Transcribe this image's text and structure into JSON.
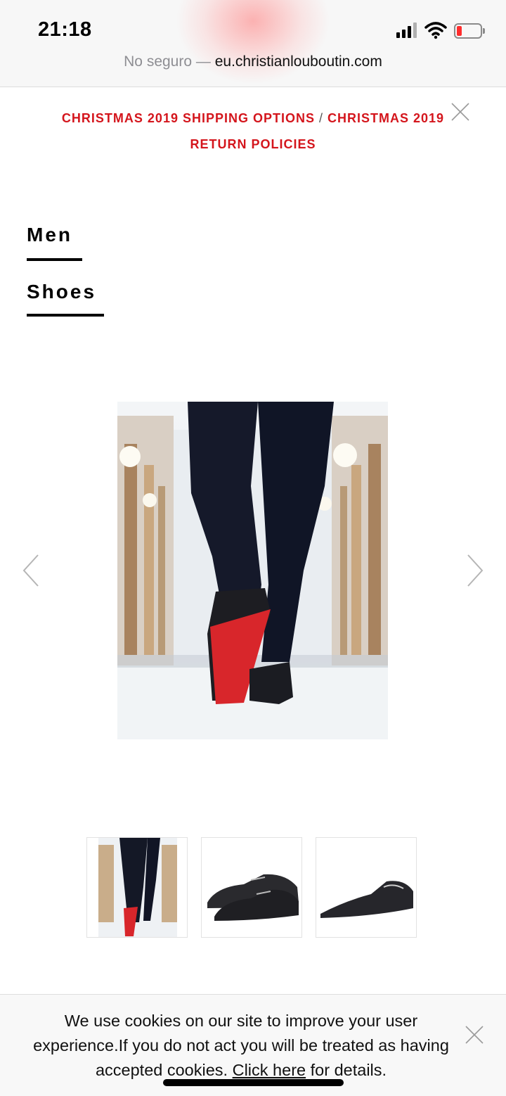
{
  "status_bar": {
    "time": "21:18",
    "icons": [
      "signal-icon",
      "wifi-icon",
      "battery-icon"
    ],
    "battery_color": "#ff2d2d"
  },
  "browser": {
    "security_label": "No seguro",
    "separator": "—",
    "domain": "eu.christianlouboutin.com"
  },
  "announcement": {
    "link_1": "CHRISTMAS 2019 SHIPPING OPTIONS",
    "separator": "/",
    "link_2": "CHRISTMAS 2019 RETURN POLICIES",
    "close_icon": "close-icon",
    "color": "#d4151c"
  },
  "breadcrumb": {
    "items": [
      {
        "label": "Men"
      },
      {
        "label": "Shoes"
      }
    ]
  },
  "carousel": {
    "prev_icon": "chevron-left-icon",
    "next_icon": "chevron-right-icon",
    "thumbnails": [
      {
        "name": "walking-legs-red-sole"
      },
      {
        "name": "black-patent-oxford-pair"
      },
      {
        "name": "black-patent-shoe-pair"
      }
    ]
  },
  "cookie_banner": {
    "text_before": "We use cookies on our site to improve your user experience.If you do not act you will be treated as having accepted cookies.",
    "link_text": "Click here",
    "text_after": "for details.",
    "close_icon": "close-icon"
  }
}
